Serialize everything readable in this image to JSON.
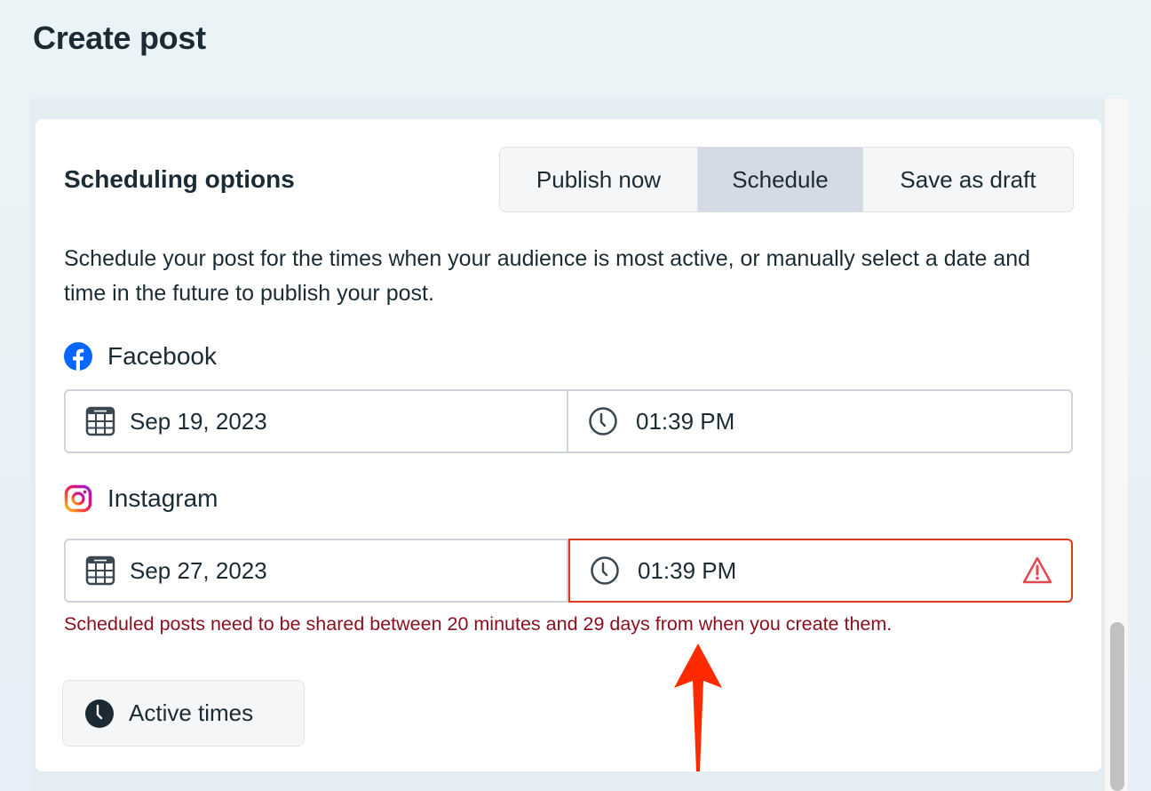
{
  "page": {
    "title": "Create post"
  },
  "scheduling": {
    "title": "Scheduling options",
    "modes": [
      {
        "label": "Publish now",
        "selected": false
      },
      {
        "label": "Schedule",
        "selected": true
      },
      {
        "label": "Save as draft",
        "selected": false
      }
    ],
    "description": "Schedule your post for the times when your audience is most active, or manually select a date and time in the future to publish your post.",
    "platforms": [
      {
        "name": "Facebook",
        "icon": "facebook-icon",
        "date": "Sep 19, 2023",
        "time": "01:39 PM",
        "error": false
      },
      {
        "name": "Instagram",
        "icon": "instagram-icon",
        "date": "Sep 27, 2023",
        "time": "01:39 PM",
        "error": true
      }
    ],
    "error_message": "Scheduled posts need to be shared between 20 minutes and 29 days from when you create them.",
    "active_times_label": "Active times"
  },
  "colors": {
    "facebook_blue": "#0866ff",
    "error_border": "#dd3a1c",
    "error_text": "#8a0f1e",
    "selected_segment": "#d5dbe5",
    "annotation_arrow": "#ff2a00"
  },
  "annotation": {
    "icon": "arrow-up-icon"
  }
}
